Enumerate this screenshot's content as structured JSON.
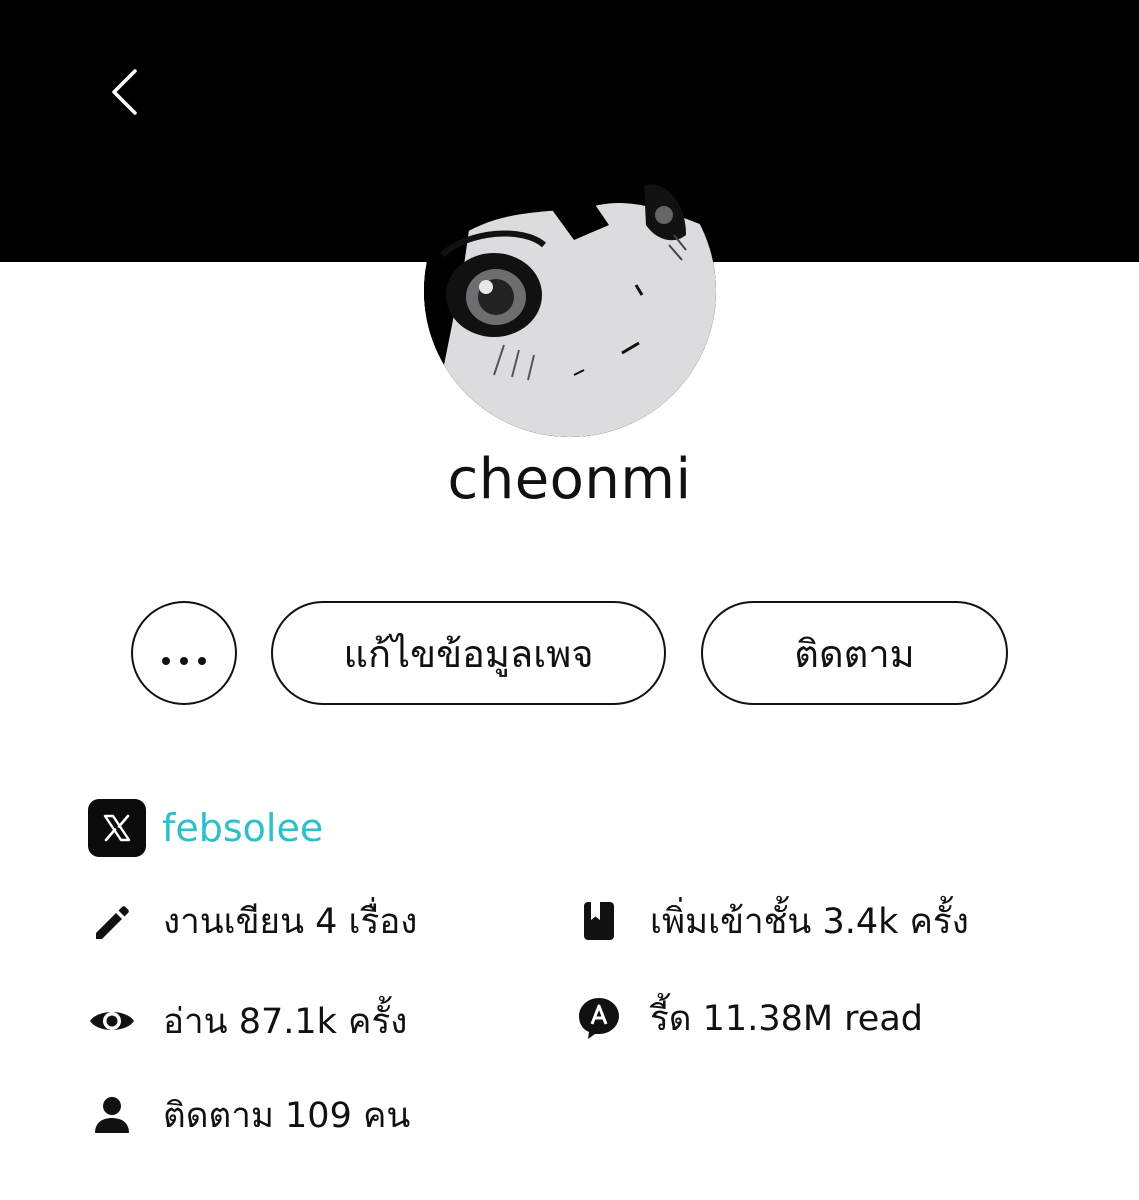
{
  "header": {
    "back_icon": "chevron-left-icon"
  },
  "profile": {
    "username": "cheonmi",
    "avatar": "manga-avatar"
  },
  "actions": {
    "more_label": "•••",
    "edit_label": "แก้ไขข้อมูลเพจ",
    "follow_label": "ติดตาม"
  },
  "social": {
    "platform_icon": "x-logo-icon",
    "handle": "febsolee",
    "handle_color": "#2cc0c9"
  },
  "stats": {
    "works": {
      "icon": "pencil-icon",
      "text": "งานเขียน 4 เรื่อง"
    },
    "shelf": {
      "icon": "bookmark-book-icon",
      "text": "เพิ่มเข้าชั้น 3.4k ครั้ง"
    },
    "reads": {
      "icon": "eye-icon",
      "text": "อ่าน 87.1k ครั้ง"
    },
    "chat_reads": {
      "icon": "chat-a-icon",
      "text": "รี้ด 11.38M read"
    },
    "followers": {
      "icon": "person-icon",
      "text": "ติดตาม 109 คน"
    }
  }
}
